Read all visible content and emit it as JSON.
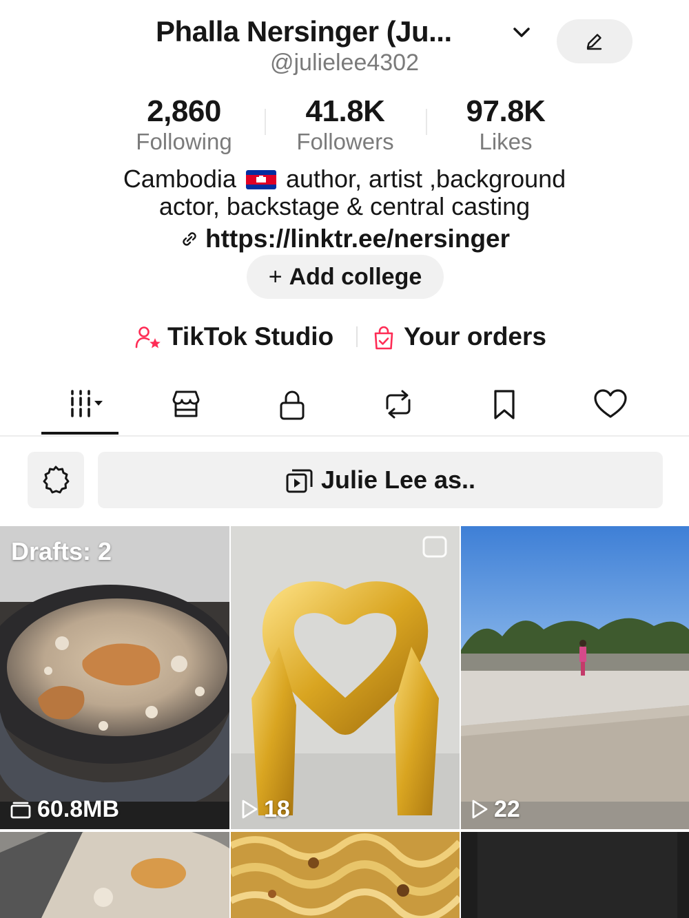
{
  "profile": {
    "display_name": "Phalla Nersinger (Ju...",
    "handle": "@julielee4302"
  },
  "stats": {
    "following": {
      "value": "2,860",
      "label": "Following"
    },
    "followers": {
      "value": "41.8K",
      "label": "Followers"
    },
    "likes": {
      "value": "97.8K",
      "label": "Likes"
    }
  },
  "bio": {
    "line1_before_flag": "Cambodia",
    "line1_after_flag": "author, artist ,background",
    "line2": "actor, backstage & central casting",
    "link": "https://linktr.ee/nersinger"
  },
  "add_college": {
    "plus": "+",
    "label": "Add college"
  },
  "shortcuts": {
    "studio_label": "TikTok Studio",
    "orders_label": "Your orders"
  },
  "tabs": [
    "videos-grid-icon",
    "shop-icon",
    "lock-icon",
    "repost-icon",
    "bookmark-icon",
    "heart-icon"
  ],
  "toolbar": {
    "playlist_label": "Julie Lee as.."
  },
  "grid": {
    "drafts_label": "Drafts: 2",
    "drafts_size": "60.8MB",
    "video2_views": "18",
    "video3_views": "22"
  },
  "colors": {
    "accent": "#fe2c55",
    "text_primary": "#161616",
    "text_secondary": "#7a7a7a",
    "button_bg": "#f1f1f1"
  }
}
